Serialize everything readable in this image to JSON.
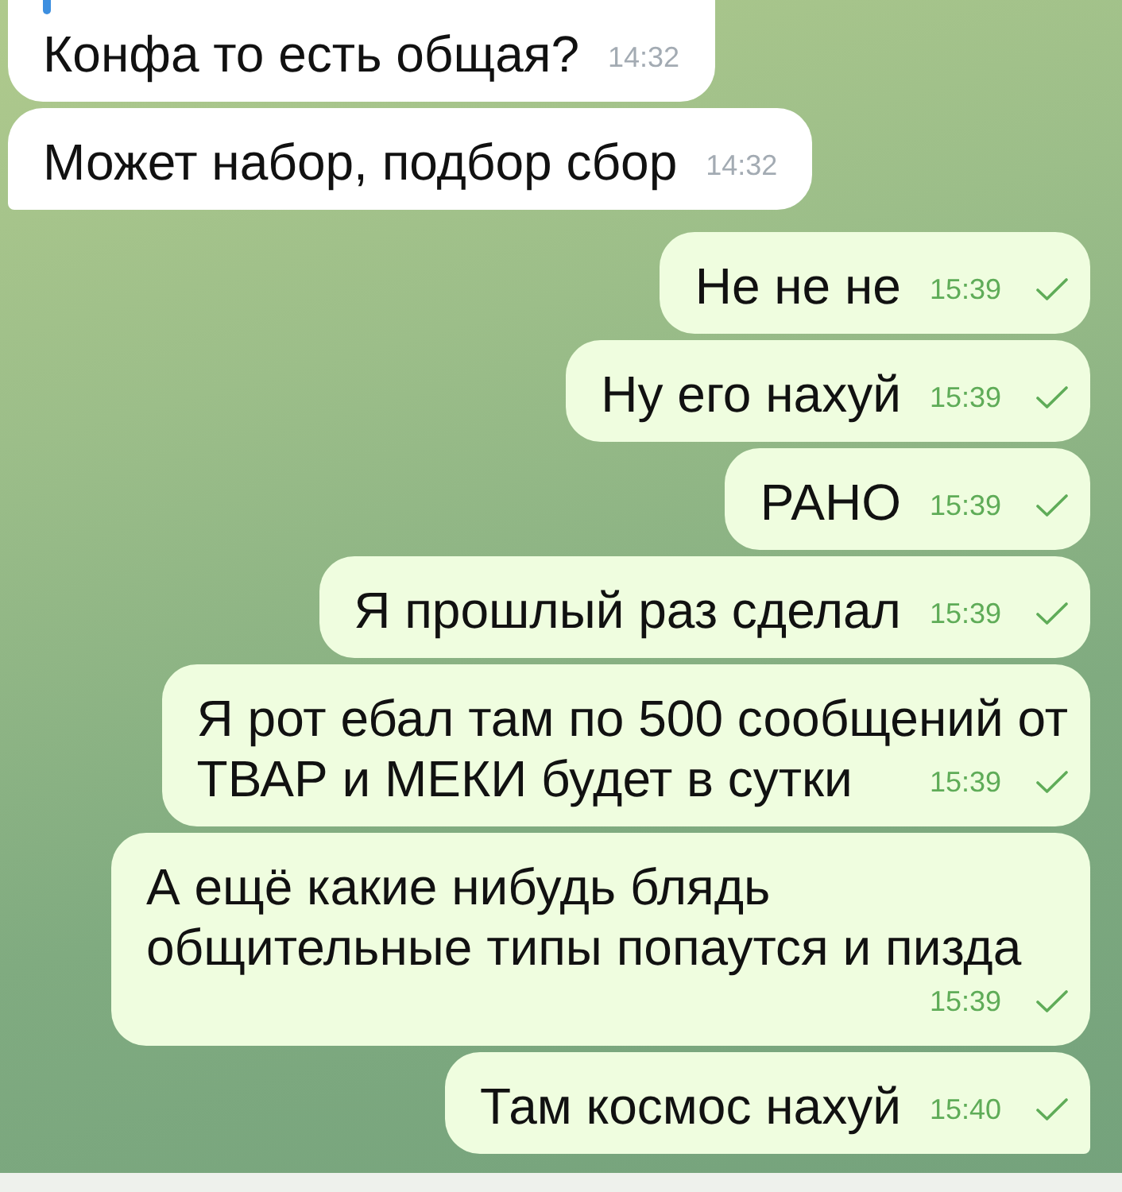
{
  "messages": [
    {
      "kind": "incoming",
      "quoted": true,
      "lines": [
        "Конфа то есть общая?"
      ],
      "time": "14:32",
      "tail": false
    },
    {
      "kind": "incoming",
      "quoted": false,
      "lines": [
        "Может набор, подбор сбор"
      ],
      "time": "14:32",
      "tail": true
    },
    {
      "kind": "outgoing",
      "quoted": false,
      "lines": [
        "Не не не"
      ],
      "time": "15:39",
      "sent": true,
      "tail": false
    },
    {
      "kind": "outgoing",
      "quoted": false,
      "lines": [
        "Ну его нахуй"
      ],
      "time": "15:39",
      "sent": true,
      "tail": false
    },
    {
      "kind": "outgoing",
      "quoted": false,
      "lines": [
        "РАНО"
      ],
      "time": "15:39",
      "sent": true,
      "tail": false
    },
    {
      "kind": "outgoing",
      "quoted": false,
      "lines": [
        "Я прошлый раз сделал"
      ],
      "time": "15:39",
      "sent": true,
      "tail": false
    },
    {
      "kind": "outgoing",
      "quoted": false,
      "lines": [
        "Я рот ебал там по 500 сообщений от",
        "ТВАР и МЕКИ будет в сутки"
      ],
      "time": "15:39",
      "sent": true,
      "tail": false
    },
    {
      "kind": "outgoing",
      "quoted": false,
      "lines": [
        "А ещё какие нибудь блядь",
        "общительные типы попаутся и пизда"
      ],
      "time": "15:39",
      "sent": true,
      "tail": false
    },
    {
      "kind": "outgoing",
      "quoted": false,
      "lines": [
        "Там космос нахуй"
      ],
      "time": "15:40",
      "sent": true,
      "tail": true
    }
  ]
}
